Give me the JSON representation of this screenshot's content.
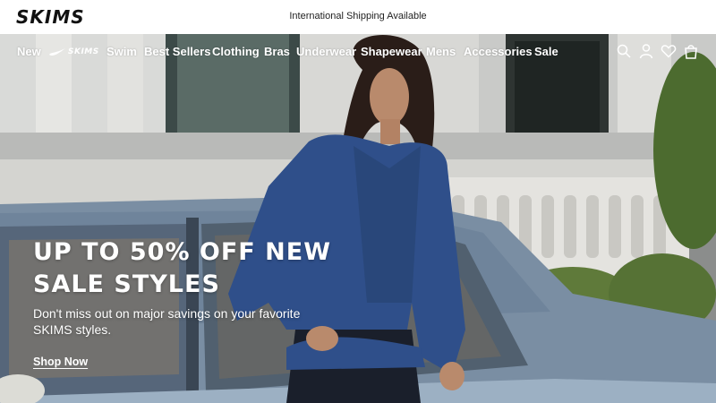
{
  "brand": {
    "logo_text": "SKIMS"
  },
  "announcement": {
    "text": "International Shipping Available"
  },
  "nav": {
    "items": [
      {
        "label": "New"
      },
      {
        "label": "Swim"
      },
      {
        "label": "Best Sellers"
      },
      {
        "label": "Clothing"
      },
      {
        "label": "Bras"
      },
      {
        "label": "Underwear"
      },
      {
        "label": "Shapewear"
      },
      {
        "label": "Mens"
      },
      {
        "label": "Accessories"
      },
      {
        "label": "Sale"
      }
    ],
    "nike_skims_label": "SKIMS",
    "icons": [
      "search-icon",
      "account-icon",
      "wishlist-icon",
      "cart-icon"
    ]
  },
  "hero": {
    "headline": "UP TO 50% OFF NEW SALE STYLES",
    "subcopy": "Don't miss out on major savings on your favorite SKIMS styles.",
    "cta_label": "Shop Now"
  },
  "colors": {
    "text_on_hero": "#ffffff",
    "cardigan": "#2f4f8a",
    "car": "#7f96ae"
  }
}
